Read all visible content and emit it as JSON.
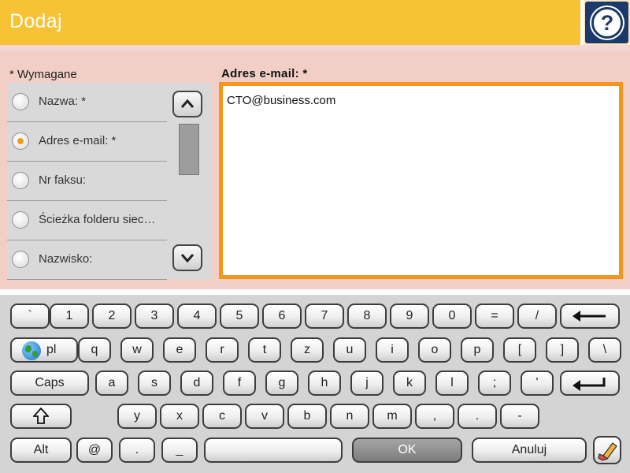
{
  "header": {
    "title": "Dodaj",
    "help_label": "?"
  },
  "form": {
    "required_note": "* Wymagane",
    "field_label": "Adres e-mail: *",
    "field_value": "CTO@business.com",
    "list_items": [
      {
        "label": "Nazwa: *",
        "selected": false
      },
      {
        "label": "Adres e-mail: *",
        "selected": true
      },
      {
        "label": "Nr faksu:",
        "selected": false
      },
      {
        "label": "Ścieżka folderu siec…",
        "selected": false
      },
      {
        "label": "Nazwisko:",
        "selected": false
      }
    ]
  },
  "keyboard": {
    "row1": [
      "`",
      "1",
      "2",
      "3",
      "4",
      "5",
      "6",
      "7",
      "8",
      "9",
      "0",
      "=",
      "/"
    ],
    "row2": [
      "pl",
      "q",
      "w",
      "e",
      "r",
      "t",
      "z",
      "u",
      "i",
      "o",
      "p",
      "[",
      "]",
      "\\"
    ],
    "row3": [
      "Caps",
      "a",
      "s",
      "d",
      "f",
      "g",
      "h",
      "j",
      "k",
      "l",
      ";",
      "'"
    ],
    "row4": [
      "y",
      "x",
      "c",
      "v",
      "b",
      "n",
      "m",
      ",",
      ".",
      "-"
    ],
    "row5": {
      "alt": "Alt",
      "at": "@",
      "dot": ".",
      "underscore": "_",
      "ok": "OK",
      "cancel": "Anuluj"
    }
  },
  "colors": {
    "header": "#f8c235",
    "accent_orange": "#f7941d",
    "help_bg": "#1b3a6b"
  },
  "icons": [
    "help-icon",
    "scroll-up-icon",
    "scroll-down-icon",
    "backspace-icon",
    "globe-icon",
    "enter-icon",
    "shift-icon",
    "clear-icon"
  ]
}
